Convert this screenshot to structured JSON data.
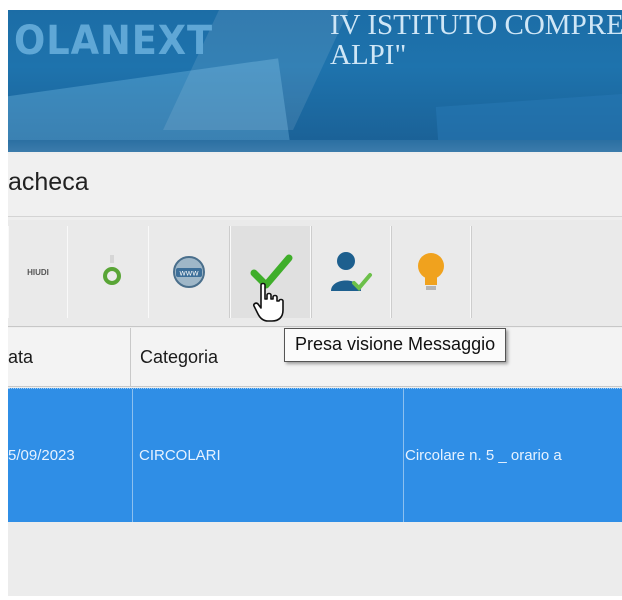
{
  "header": {
    "logo_text": "OLANEXT",
    "school_name_line1": "IV ISTITUTO COMPRENS",
    "school_name_line2": "ALPI\""
  },
  "board": {
    "title": "acheca"
  },
  "toolbar": {
    "close_label": "HIUDI",
    "buttons": [
      "attachment-icon",
      "web-icon",
      "checkmark-icon",
      "user-confirm-icon",
      "lightbulb-icon"
    ]
  },
  "table": {
    "columns": [
      "ata",
      "Categoria"
    ],
    "rows": [
      {
        "date": "5/09/2023",
        "category": "CIRCOLARI",
        "subject": "Circolare n. 5 _ orario a"
      }
    ],
    "selected_row_color": "#2f8ee6"
  },
  "tooltip": {
    "text": "Presa visione Messaggio"
  },
  "colors": {
    "header_blue": "#1e73ad",
    "check_green": "#3fae2a",
    "idea_orange": "#f0a21e"
  }
}
